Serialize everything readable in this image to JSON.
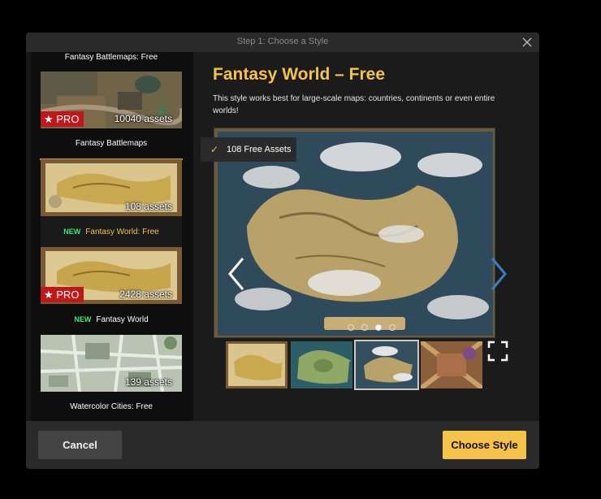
{
  "window": {
    "title": "Step 1: Choose a Style"
  },
  "sidebar": {
    "partial_item": {
      "label": "Fantasy Battlemaps: Free"
    },
    "items": [
      {
        "label": "Fantasy Battlemaps",
        "badge": "★ PRO",
        "assets": "10040 assets",
        "is_new": false
      },
      {
        "label": "Fantasy World: Free",
        "new_label": "NEW",
        "assets": "108 assets",
        "selected": true
      },
      {
        "label": "Fantasy World",
        "new_label": "NEW",
        "badge": "★ PRO",
        "assets": "2428 assets"
      },
      {
        "label": "Watercolor Cities: Free",
        "assets": "139 assets"
      }
    ]
  },
  "main": {
    "heading": "Fantasy World – Free",
    "description": "This style works best for large-scale maps: countries, continents or even entire worlds!",
    "free_tag": "108 Free Assets",
    "check_icon": "✓",
    "active_dot": 2
  },
  "footer": {
    "cancel": "Cancel",
    "choose": "Choose Style"
  },
  "colors": {
    "accent": "#f5c34a",
    "pro_red": "#c0171a",
    "new_green": "#3fe67c"
  }
}
